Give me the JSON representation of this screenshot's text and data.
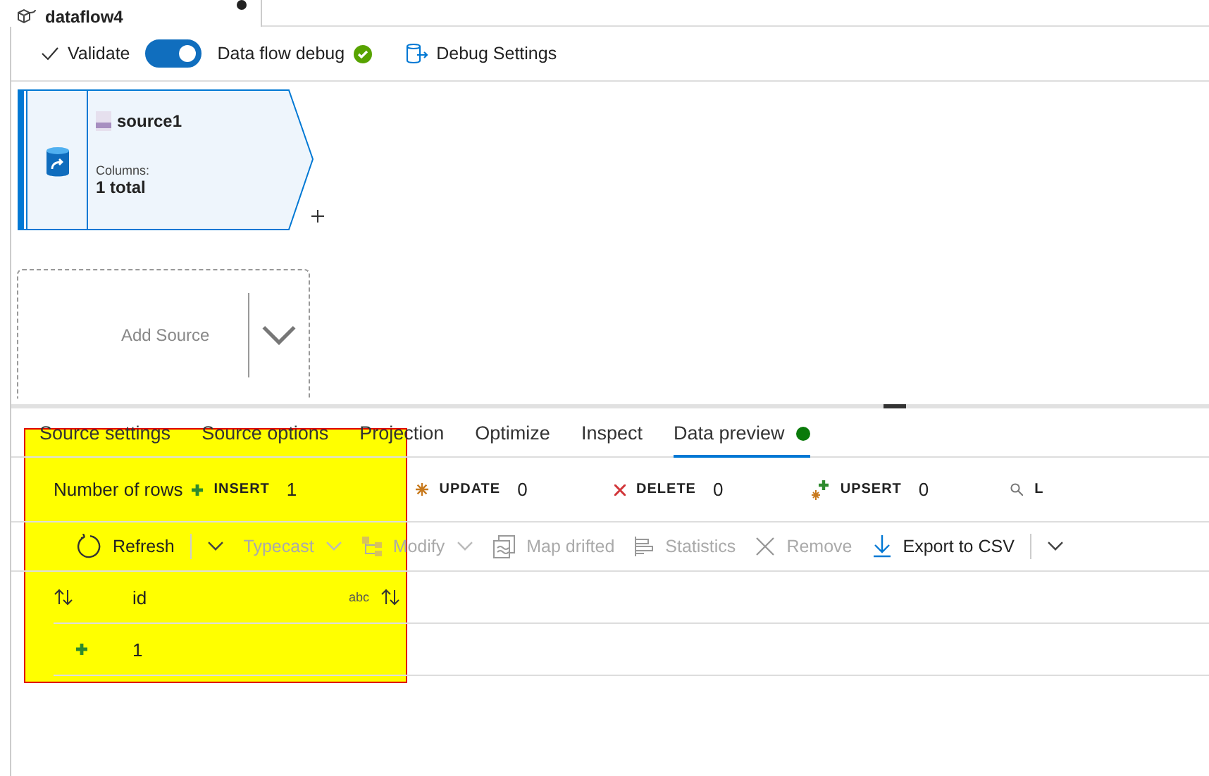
{
  "document_tab": {
    "title": "dataflow4",
    "unsaved": true
  },
  "toolbar": {
    "validate": "Validate",
    "debug_toggle": {
      "label": "Data flow debug",
      "on": true,
      "healthy": true
    },
    "debug_settings": "Debug Settings"
  },
  "canvas": {
    "source_node": {
      "name": "source1",
      "columns_label": "Columns:",
      "columns_value": "1 total",
      "selected": true
    },
    "add_source": "Add Source"
  },
  "tabs": [
    {
      "label": "Source settings",
      "selected": false,
      "healthy": false
    },
    {
      "label": "Source options",
      "selected": false,
      "healthy": false
    },
    {
      "label": "Projection",
      "selected": false,
      "healthy": false
    },
    {
      "label": "Optimize",
      "selected": false,
      "healthy": false
    },
    {
      "label": "Inspect",
      "selected": false,
      "healthy": false
    },
    {
      "label": "Data preview",
      "selected": true,
      "healthy": true
    }
  ],
  "row_counts": {
    "label": "Number of rows",
    "items": [
      {
        "kind": "insert",
        "label": "INSERT",
        "count": "1"
      },
      {
        "kind": "update",
        "label": "UPDATE",
        "count": "0"
      },
      {
        "kind": "delete",
        "label": "DELETE",
        "count": "0"
      },
      {
        "kind": "upsert",
        "label": "UPSERT",
        "count": "0"
      },
      {
        "kind": "lookup",
        "label": "L"
      }
    ]
  },
  "grid_toolbar": [
    {
      "kind": "refresh",
      "label": "Refresh",
      "disabled": false,
      "dropdown": false,
      "split_dropdown": true
    },
    {
      "kind": "typecast",
      "label": "Typecast",
      "disabled": true,
      "dropdown": true,
      "split_dropdown": false
    },
    {
      "kind": "modify",
      "label": "Modify",
      "disabled": true,
      "dropdown": true,
      "split_dropdown": false
    },
    {
      "kind": "map",
      "label": "Map drifted",
      "disabled": true,
      "dropdown": false,
      "split_dropdown": false
    },
    {
      "kind": "statistics",
      "label": "Statistics",
      "disabled": true,
      "dropdown": false,
      "split_dropdown": false
    },
    {
      "kind": "remove",
      "label": "Remove",
      "disabled": true,
      "dropdown": false,
      "split_dropdown": false
    },
    {
      "kind": "export",
      "label": "Export to CSV",
      "disabled": false,
      "dropdown": false,
      "split_dropdown": true
    }
  ],
  "table": {
    "columns": [
      {
        "name": "id",
        "type": "abc"
      }
    ],
    "rows": [
      {
        "kind": "insert",
        "cells": [
          "1"
        ]
      }
    ]
  }
}
